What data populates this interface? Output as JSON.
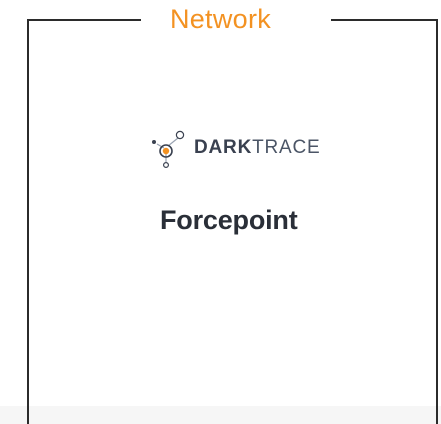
{
  "section": {
    "title": "Network"
  },
  "logos": {
    "darktrace": {
      "bold": "DARK",
      "light": "TRACE",
      "icon": "darktrace-node-icon"
    },
    "forcepoint": {
      "text": "Forcepoint"
    }
  },
  "colors": {
    "accent": "#f39222",
    "frame": "#2b2b2b",
    "logo_text": "#3a4150"
  }
}
